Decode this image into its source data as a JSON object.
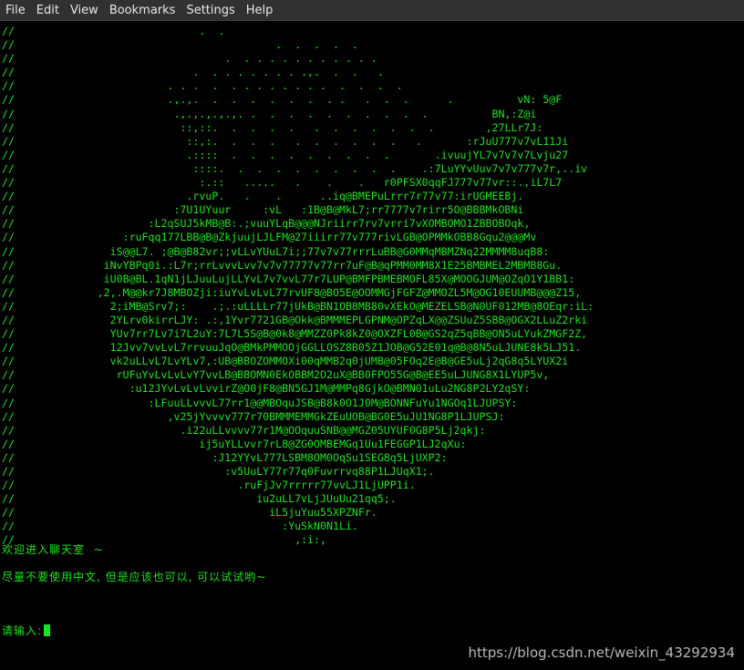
{
  "menubar": {
    "items": [
      "File",
      "Edit",
      "View",
      "Bookmarks",
      "Settings",
      "Help"
    ]
  },
  "terminal": {
    "ascii_art": [
      "//                             .  .",
      "//                                         .  .  .  .  .",
      "//                                 .  . . . . . . . . . . .",
      "//                            .  . . . . . . . .,.  .  .   .",
      "//                        . . .  .  . . . . . . . .  .  .  .  .",
      "//                        .,.,.  .  .  .  .  .  .  . .   .  .  .      .          vN: 5@F",
      "//                         .,.,.,.,.,. .  .  .  .  .  .  .  .  .  .          BN,:Z@i",
      "//                          ::,::.  .  .  .  .   .  .  .  .  .  .  .        ,27LLr7J:",
      "//                           ::,:.  .  .  .   .  .  .  .  .  .   .       :rJuU777v7vL11Ji",
      "//                           .::::  .  .  .  .  .  .  .  .  .       .ivuujYL7v7v7v7Lvju27",
      "//                            ::::.  .  .  .  .  .  .  .  .  .    .:7LuYYvUuv7v7v777v7r,..iv",
      "//                             :.::   .....   .    .    .   r0PFSX0qqFJ777v77vr::.,iL7L7",
      "//                           .rvuP.   .    .      ..iq@BMEPuLrrr7r77v77:irUGMEEBj.",
      "//                         :7U1UYuur     :vL   :1B@B@MkL7;rr7777v7rirr5O@BBBMkOBNi",
      "//                     :L2qSUJ5kMB@B:.;vuuYLqB@@@NJriirr7rv7vrri7vXOMBOMO1ZBBOBOqk,",
      "//                 :ruFqq177LBB@B@ZkjuujLJLFM@27iiirr77v777rivLGB@OPMMkOBB8Gqu2@@@Mv",
      "//               iS@@L7. ;@B@B82vr;;vLLvYUuL7i;;77v7v77rrrLuBB@G0MMqMBMZNq22MMMM8uqB8:",
      "//              iNvYBPq0i.:L7r;rrLvvvLvv7v7v77777v77rr7uF@B@qPMM0MM8X1E25BMBMEL2MBMB8Gu.",
      "//              iU0B@BL.1qN1jLJuuLujLLYvL7v7vvL77r7LUP@BMFPBMEBMOFL85X@MOOGJUM@OZqO1Y1BB1:",
      "//             ,2,.M@@kr7J8MBOZji:iuYvLvLvL77rvUF8@BO5E@OOMMGjFGFZ@MMOZL5M@OG10EUUMB@@@Z15,",
      "//               2;iMB@Srv7;:    .;.:uLLLLr77jUkB@BN1OB8MB80vXEkO@MEZELSB@N0UF012MB@8OEqr:iL:",
      "//               2YLrv0kirrLJY: .:,1Yvr7721GB@Okk@BMMMEPLGPNM@OPZqLX@@ZSUuZ5SBB@OGX2LLuZ2rki",
      "//               YUv7rr7Lv7i7L2uY:7L7L5S@B@0k8@MMZZ0Pk8kZ0@OXZFL0B@GS2qZ5qBB@ON5uLYukZMGF2Z,",
      "//               12Jvv7vvLvL7rrvuuJqO@BMkPMMOOjGGLLOSZ8B05Z1JOB@G52E01q@B@8N5uLJUNE8k5LJ51.",
      "//               vk2uLLvL7LvYLv7,:UB@BBOZOMMOXi00qMMB2q0jUMB@05FOq2E@B@GE5uLj2qG8q5LYUX2i",
      "//                rUFuYvLvLvLvY7vvLB@BBOMN0EkOBBM2O2uX@BB0FPO55G@B@EE5uLJUNG8X1LYUP5v,",
      "//                  :u12JYvLvLvLvvirZ@O0jF8@BN5GJ1M@MMPq8GjkO@BMN01uLu2NG8P2LY2qSY:",
      "//                     :LFuuLLvvvL77rr1@@MBOquJSB@B8k0O1J0M@BONNFuYu1NGOq1LJUPSY:",
      "//                        ,v25jYvvvv777r70BMMMEMMGkZEuUOB@BG0E5uJU1NG8P1LJUPSJ:",
      "//                          .i22uLLvvvv77r1M@OOquuSNB@@MGZ05UYUF0G8P5Lj2qkj:",
      "//                             ij5uYLLvvr7rL8@ZG0OMBEMGq1Uu1FEGGP1LJ2qXu:",
      "//                               :J12YYvL777LSBM8OM0OqSu1SEG8q5LjUXP2:",
      "//                                 :v5UuLY77r77q0Fuvrrvq88P1LJUqX1;.",
      "//                                   .ruFjJv7rrrrr77vvLJ1LjUPP1i.",
      "//                                      iu2uLL7vLjJUuUu21qq5;.",
      "//                                        iL5juYuu55XPZNFr.",
      "//                                          :YuSkN0N1Li.",
      "//                                            ,:i:,"
    ],
    "welcome": "欢迎进入聊天室  ~",
    "hint": "尽量不要使用中文, 但是应该也可以, 可以试试哟~",
    "prompt": "请输入:"
  },
  "watermark": "https://blog.csdn.net/weixin_43292934",
  "colors": {
    "terminal_fg": "#19e619",
    "terminal_bg": "#000000",
    "menubar_bg": "#2f3133",
    "menubar_fg": "#e8e8e8"
  }
}
